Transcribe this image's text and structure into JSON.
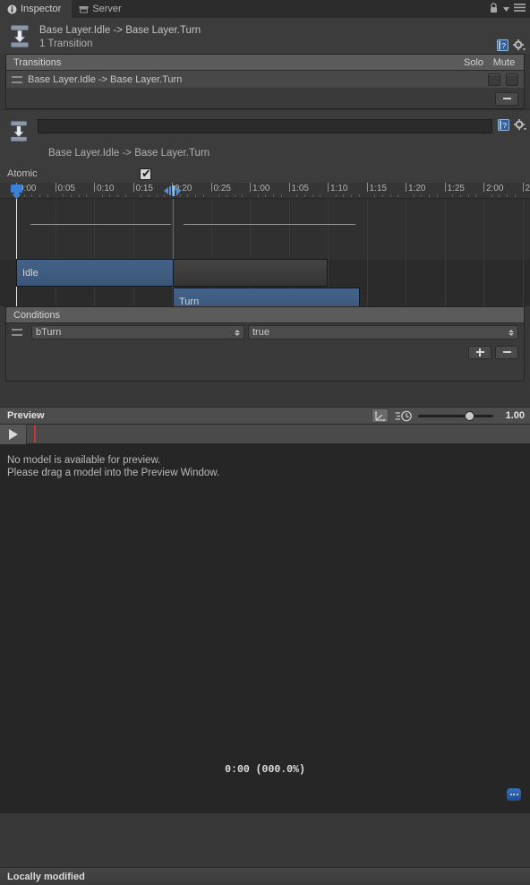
{
  "window": {
    "tabs": [
      {
        "label": "Inspector",
        "icon": "info-icon",
        "active": true
      },
      {
        "label": "Server",
        "icon": "server-icon",
        "active": false
      }
    ],
    "lock_icon": "lock-icon",
    "menu_icon": "hamburger-menu-icon"
  },
  "inspector": {
    "icon": "transition-icon",
    "title": "Base Layer.Idle -> Base Layer.Turn",
    "subtitle": "1 Transition",
    "help_icon": "help-book-icon",
    "settings_icon": "gear-icon"
  },
  "transitions_panel": {
    "header": "Transitions",
    "col_solo": "Solo",
    "col_mute": "Mute",
    "rows": [
      {
        "label": "Base Layer.Idle -> Base Layer.Turn",
        "solo": false,
        "mute": false
      }
    ],
    "remove_label": "−"
  },
  "transition_detail": {
    "icon": "transition-icon",
    "name_value": "",
    "name_placeholder": "",
    "subtitle": "Base Layer.Idle -> Base Layer.Turn",
    "help_icon": "help-book-icon",
    "settings_icon": "gear-icon"
  },
  "atomic": {
    "label": "Atomic",
    "checked": true,
    "check_glyph": "✔"
  },
  "timeline": {
    "tick_labels": [
      "0:00",
      "0:05",
      "0:10",
      "0:15",
      "0:20",
      "0:25",
      "1:00",
      "1:05",
      "1:10",
      "1:15",
      "1:20",
      "1:25",
      "2:00",
      "2"
    ],
    "start_marker_icon": "timeline-start-marker-icon",
    "duration_handle_icon": "transition-duration-handle-icon",
    "clips": [
      {
        "name": "Idle",
        "kind": "source"
      },
      {
        "name": "",
        "kind": "source-tail"
      },
      {
        "name": "Turn",
        "kind": "destination"
      }
    ]
  },
  "conditions_panel": {
    "header": "Conditions",
    "rows": [
      {
        "parameter": "bTurn",
        "value": "true"
      }
    ],
    "add_label": "+",
    "remove_label": "−"
  },
  "preview": {
    "title": "Preview",
    "pivot_icon": "pivot-axis-icon",
    "speed_icon": "playback-speed-clock-icon",
    "slider_value": "1.00",
    "play_icon": "play-icon",
    "message_line1": "No model is available for preview.",
    "message_line2": "Please drag a model into the Preview Window.",
    "time_readout": "0:00 (000.0%)",
    "options_icon": "more-options-icon"
  },
  "status": {
    "text": "Locally modified"
  },
  "colors": {
    "accent_blue": "#3d7fd0",
    "clip_blue": "#3d5a7d",
    "panel_header": "#5b5b5b",
    "background": "#383838",
    "playhead_red": "#c8373a"
  }
}
